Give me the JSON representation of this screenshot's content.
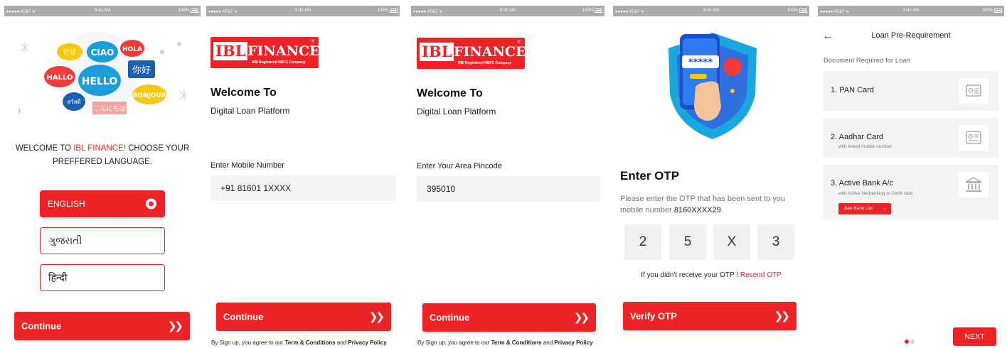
{
  "status": {
    "carrier": "●●●●● AT&T ᯤ",
    "time": "9:41 AM",
    "battery": "100%"
  },
  "colors": {
    "accent": "#ee2326",
    "field_bg": "#f4f4f4",
    "status_bar": "#ababab"
  },
  "logo": {
    "ibl": "IBL",
    "finance": "FINANCE",
    "tagline": "RBI Registered NBFC Company",
    "registered": "®"
  },
  "screen1": {
    "bubbles": [
      "안녕",
      "CIAO",
      "HOLA",
      "HALLO",
      "HELLO",
      "你好",
      "สวัสดี",
      "こんにちは",
      "BONJOUR"
    ],
    "welcome_prefix": "WELCOME TO ",
    "welcome_brand": "IBL FINANCE!",
    "welcome_suffix": " CHOOSE YOUR",
    "welcome_line2": "PREFFERED LANGUAGE.",
    "languages": [
      {
        "label": "ENGLISH",
        "selected": true
      },
      {
        "label": "ગુજરાતી",
        "selected": false
      },
      {
        "label": "हिन्दी",
        "selected": false
      }
    ],
    "continue_label": "Continue",
    "continue_icon": "double-chevron-right"
  },
  "screen2": {
    "title": "Welcome To",
    "subtitle": "Digital Loan Platform",
    "field_label": "Enter Mobile Number",
    "field_value": "+91 81601 1XXXX",
    "continue_label": "Continue",
    "terms_prefix": "By Sign up, you agree to our ",
    "terms_link": "Term & Conditions",
    "terms_and": " and ",
    "privacy_link": "Privacy Policy"
  },
  "screen3": {
    "title": "Welcome To",
    "subtitle": "Digital Loan Platform",
    "field_label": "Enter Your Area Pincode",
    "field_value": "395010",
    "continue_label": "Continue",
    "terms_prefix": "By Sign up, you agree to our ",
    "terms_link": "Term & Conditions",
    "terms_and": " and ",
    "privacy_link": "Privacy Policy"
  },
  "screen4": {
    "phone_mask": "*****",
    "title": "Enter OTP",
    "desc": "Please enter the OTP that has been sent to you mobile number ",
    "mobile": "8160XXXX29",
    "otp_digits": [
      "2",
      "5",
      "X",
      "3"
    ],
    "resend_prefix": "If you didn't receive your OTP ! ",
    "resend_link": "Resend OTP",
    "verify_label": "Verify OTP"
  },
  "screen5": {
    "back_icon": "arrow-left",
    "title": "Loan Pre-Requirement",
    "subtitle": "Document Required for Loan",
    "documents": [
      {
        "name": "1. PAN Card",
        "note": "",
        "icon": "id-card-icon"
      },
      {
        "name": "2. Aadhar Card",
        "note": "with linked mobile number",
        "icon": "id-card-icon"
      },
      {
        "name": "3. Active Bank A/c",
        "note": "with Active Netbanking or Debit card",
        "icon": "bank-icon"
      }
    ],
    "see_bank_label": "See Bank List",
    "pager": {
      "count": 2,
      "active": 1
    },
    "next_label": "NEXT"
  }
}
